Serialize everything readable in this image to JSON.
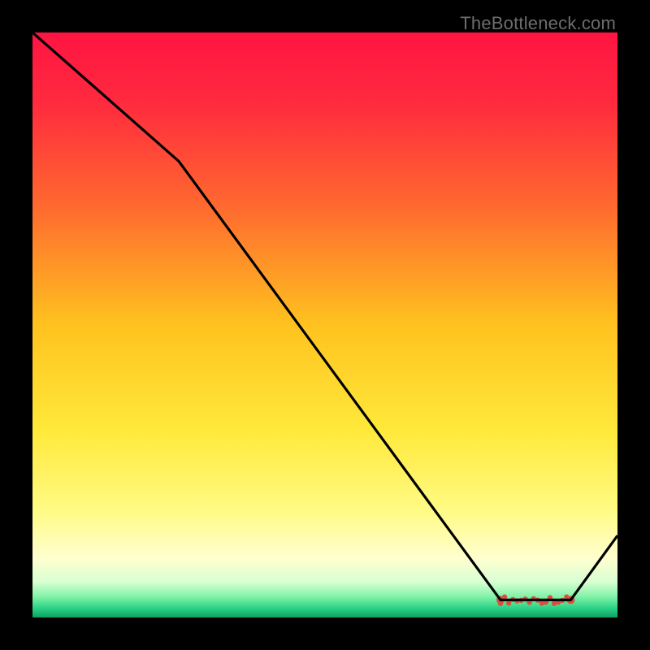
{
  "watermark": "TheBottleneck.com",
  "chart_data": {
    "type": "line",
    "title": "",
    "xlabel": "",
    "ylabel": "",
    "xlim": [
      0,
      100
    ],
    "ylim": [
      0,
      100
    ],
    "x": [
      0,
      25,
      80,
      85,
      92,
      100
    ],
    "values": [
      100,
      78,
      3,
      3,
      3,
      14
    ],
    "marker_region_x": [
      80,
      92
    ],
    "gradient_stops": [
      {
        "offset": 0.0,
        "color": "#ff1442"
      },
      {
        "offset": 0.12,
        "color": "#ff2a3e"
      },
      {
        "offset": 0.3,
        "color": "#ff6a2f"
      },
      {
        "offset": 0.5,
        "color": "#ffc21f"
      },
      {
        "offset": 0.68,
        "color": "#ffe93a"
      },
      {
        "offset": 0.82,
        "color": "#fffb86"
      },
      {
        "offset": 0.9,
        "color": "#ffffd0"
      },
      {
        "offset": 0.94,
        "color": "#d7ffd2"
      },
      {
        "offset": 0.965,
        "color": "#7ef2a6"
      },
      {
        "offset": 0.985,
        "color": "#27d084"
      },
      {
        "offset": 1.0,
        "color": "#0fa060"
      }
    ],
    "line_color": "#000000",
    "marker_color": "#d84f3e"
  }
}
